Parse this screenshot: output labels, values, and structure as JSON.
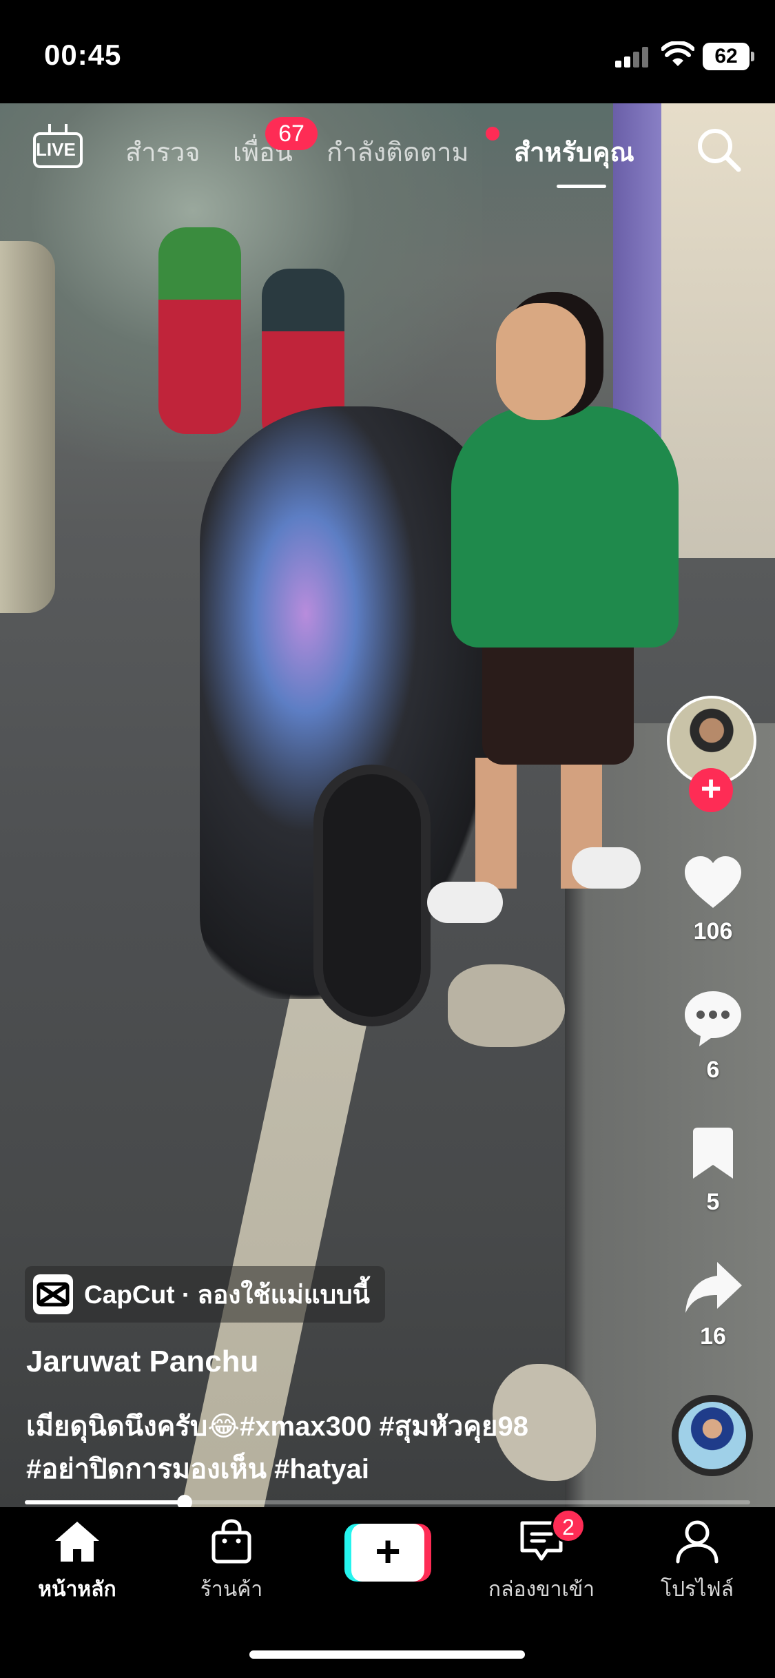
{
  "status_bar": {
    "time": "00:45",
    "battery": "62"
  },
  "top_nav": {
    "live_label": "LIVE",
    "tabs": [
      {
        "label": "สำรวจ"
      },
      {
        "label": "เพื่อน"
      },
      {
        "label": "กำลังติดตาม"
      },
      {
        "label": "สำหรับคุณ"
      }
    ],
    "friends_badge": "67",
    "active_tab": "สำหรับคุณ"
  },
  "actions": {
    "likes": "106",
    "comments": "6",
    "saves": "5",
    "shares": "16",
    "follow_symbol": "+"
  },
  "video": {
    "capcut_label": "CapCut · ลองใช้แม่แบบนี้",
    "author": "Jaruwat Panchu",
    "caption": "เมียดุนิดนึงครับ😂#xmax300 #สุมหัวคุย98 #อย่าปิดการมองเห็น #hatyai",
    "progress": 0.22
  },
  "tab_bar": {
    "home": "หน้าหลัก",
    "shop": "ร้านค้า",
    "create_symbol": "+",
    "inbox": "กล่องขาเข้า",
    "inbox_badge": "2",
    "profile": "โปรไฟล์"
  },
  "colors": {
    "accent": "#fe2c55",
    "cyan": "#25f4ee"
  },
  "icons": [
    "live-icon",
    "search-icon",
    "heart-icon",
    "comment-icon",
    "bookmark-icon",
    "share-icon",
    "home-icon",
    "shop-icon",
    "plus-icon",
    "inbox-icon",
    "profile-icon"
  ]
}
